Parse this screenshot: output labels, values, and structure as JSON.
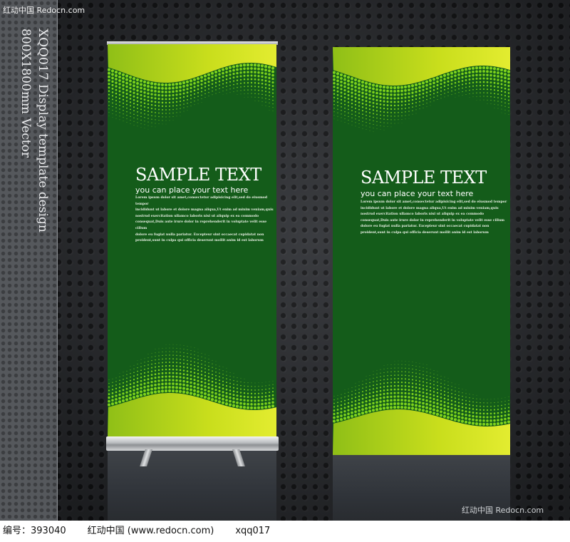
{
  "watermark": {
    "top": "红动中国 Redocn.com",
    "bottom": "红动中国 Redocn.com"
  },
  "side_title": {
    "line1": "XQQ017 Display template design",
    "line2": "800X1800mm Vector"
  },
  "banners": [
    {
      "title": "SAMPLE TEXT",
      "subtitle": "you can place your text here",
      "body": [
        "Lorem ipsum dolor sit amet,consectetur adipisicing elit,sed do eiusmod tempor",
        "incididunt ut labore et dolore magna aliqua,Ut enim ad minim veniam,quis",
        "nostrud exercitation ullamco laboris nisi ut aliquip ex ea commodo",
        "consequat,Duis aute irure dolor in reprehenderit in voluptate velit esse cillum",
        "dolore eu fugiat nulla pariatur. Excepteur sint occaecat cupidatat non",
        "proident,sunt in culpa qui officia deserunt mollit anim id est laborum"
      ]
    },
    {
      "title": "SAMPLE TEXT",
      "subtitle": "you can place your text here",
      "body": [
        "Lorem ipsum dolor sit amet,consectetur adipisicing elit,sed do eiusmod tempor",
        "incididunt ut labore et dolore magna aliqua,Ut enim ad minim veniam,quis",
        "nostrud exercitation ullamco laboris nisi ut aliquip ex ea commodo",
        "consequat,Duis aute irure dolor in reprehenderit in voluptate velit esse cillum",
        "dolore eu fugiat nulla pariatur. Excepteur sint occaecat cupidatat non",
        "proident,sunt in culpa qui officia deserunt mollit anim id est laborum"
      ]
    }
  ],
  "footer": {
    "id_label": "编号：393040",
    "site": "红动中国 (www.redocn.com)",
    "author": "xqq017"
  },
  "colors": {
    "banner_green": "#145c1a",
    "wave_lime": "#c7dc1a",
    "dot_green": "#7ed31c"
  }
}
